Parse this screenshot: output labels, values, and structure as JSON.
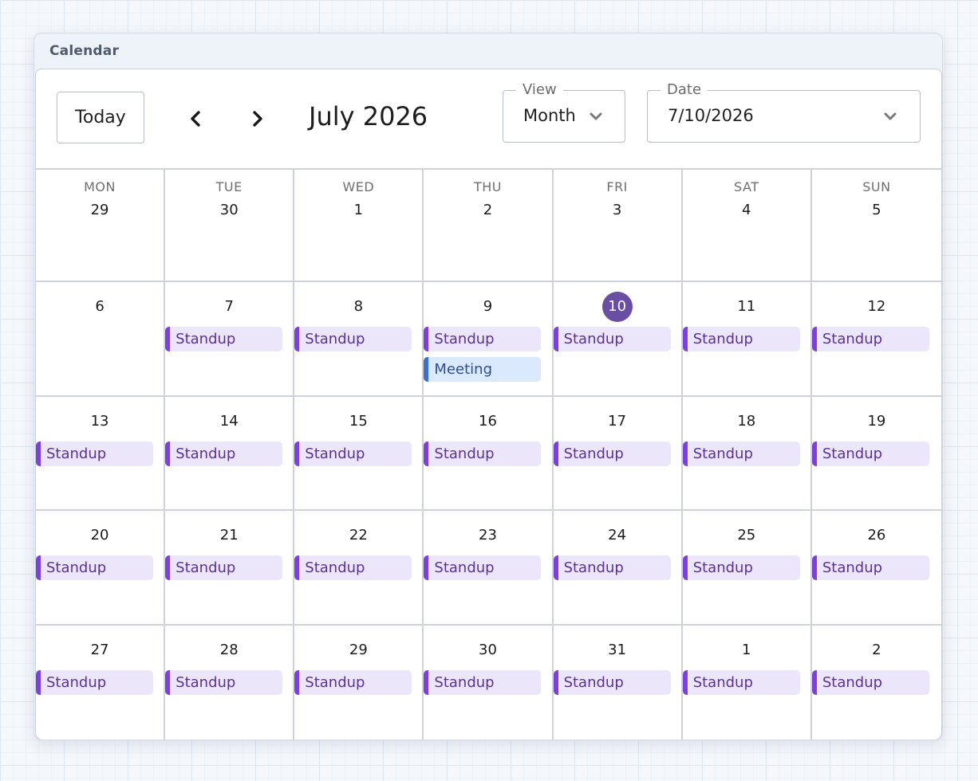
{
  "window": {
    "title": "Calendar"
  },
  "toolbar": {
    "today_label": "Today",
    "month_label": "July 2026",
    "view": {
      "legend": "View",
      "value": "Month"
    },
    "date": {
      "legend": "Date",
      "value": "7/10/2026"
    }
  },
  "calendar": {
    "weekdays": [
      "MON",
      "TUE",
      "WED",
      "THU",
      "FRI",
      "SAT",
      "SUN"
    ],
    "today": "10",
    "colors": {
      "standup": "#7b3fe4",
      "meeting": "#3a6fd8",
      "today": "#6a4ea3"
    },
    "weeks": [
      [
        {
          "day": "29",
          "events": []
        },
        {
          "day": "30",
          "events": []
        },
        {
          "day": "1",
          "events": []
        },
        {
          "day": "2",
          "events": []
        },
        {
          "day": "3",
          "events": []
        },
        {
          "day": "4",
          "events": []
        },
        {
          "day": "5",
          "events": []
        }
      ],
      [
        {
          "day": "6",
          "events": []
        },
        {
          "day": "7",
          "events": [
            "Standup"
          ]
        },
        {
          "day": "8",
          "events": [
            "Standup"
          ]
        },
        {
          "day": "9",
          "events": [
            "Standup",
            "Meeting"
          ]
        },
        {
          "day": "10",
          "events": [
            "Standup"
          ]
        },
        {
          "day": "11",
          "events": [
            "Standup"
          ]
        },
        {
          "day": "12",
          "events": [
            "Standup"
          ]
        }
      ],
      [
        {
          "day": "13",
          "events": [
            "Standup"
          ]
        },
        {
          "day": "14",
          "events": [
            "Standup"
          ]
        },
        {
          "day": "15",
          "events": [
            "Standup"
          ]
        },
        {
          "day": "16",
          "events": [
            "Standup"
          ]
        },
        {
          "day": "17",
          "events": [
            "Standup"
          ]
        },
        {
          "day": "18",
          "events": [
            "Standup"
          ]
        },
        {
          "day": "19",
          "events": [
            "Standup"
          ]
        }
      ],
      [
        {
          "day": "20",
          "events": [
            "Standup"
          ]
        },
        {
          "day": "21",
          "events": [
            "Standup"
          ]
        },
        {
          "day": "22",
          "events": [
            "Standup"
          ]
        },
        {
          "day": "23",
          "events": [
            "Standup"
          ]
        },
        {
          "day": "24",
          "events": [
            "Standup"
          ]
        },
        {
          "day": "25",
          "events": [
            "Standup"
          ]
        },
        {
          "day": "26",
          "events": [
            "Standup"
          ]
        }
      ],
      [
        {
          "day": "27",
          "events": [
            "Standup"
          ]
        },
        {
          "day": "28",
          "events": [
            "Standup"
          ]
        },
        {
          "day": "29",
          "events": [
            "Standup"
          ]
        },
        {
          "day": "30",
          "events": [
            "Standup"
          ]
        },
        {
          "day": "31",
          "events": [
            "Standup"
          ]
        },
        {
          "day": "1",
          "events": [
            "Standup"
          ]
        },
        {
          "day": "2",
          "events": [
            "Standup"
          ]
        }
      ]
    ]
  }
}
